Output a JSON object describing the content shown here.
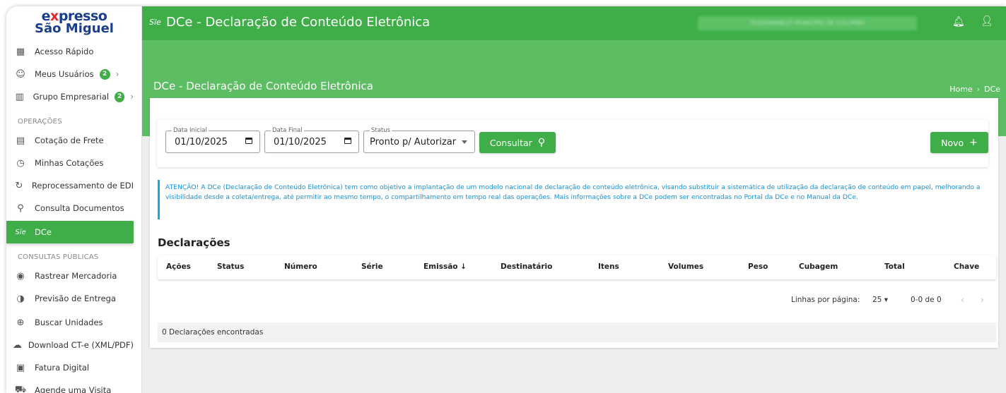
{
  "brand": {
    "logo_top_prefix": "e",
    "logo_top_accent": "x",
    "logo_top_rest": "presso",
    "logo_bottom": "São Miguel"
  },
  "sidebar": {
    "items": [
      {
        "label": "Acesso Rápido",
        "icon": "grid-icon"
      },
      {
        "label": "Meus Usuários",
        "icon": "face-icon",
        "badge": "2"
      },
      {
        "label": "Grupo Empresarial",
        "icon": "building-icon",
        "badge": "2"
      }
    ],
    "section_ops": "OPERAÇÕES",
    "ops_items": [
      {
        "label": "Cotação de Frete",
        "icon": "clipboard-icon"
      },
      {
        "label": "Minhas Cotações",
        "icon": "clock-icon"
      },
      {
        "label": "Reprocessamento de EDI",
        "icon": "sync-icon"
      },
      {
        "label": "Consulta Documentos",
        "icon": "search-icon"
      },
      {
        "label": "DCe",
        "icon": "dce-icon",
        "icon_text": "Sïe"
      }
    ],
    "section_public": "CONSULTAS PÚBLICAS",
    "public_items": [
      {
        "label": "Rastrear Mercadoria",
        "icon": "target-icon"
      },
      {
        "label": "Previsão de Entrega",
        "icon": "half-circle-icon"
      },
      {
        "label": "Buscar Unidades",
        "icon": "add-circle-icon"
      },
      {
        "label": "Download CT-e (XML/PDF)",
        "icon": "cloud-download-icon"
      },
      {
        "label": "Fatura Digital",
        "icon": "pdf-icon"
      },
      {
        "label": "Agende uma Visita",
        "icon": "truck-icon"
      }
    ]
  },
  "topbar": {
    "icon_text": "Sïe",
    "title": "DCe - Declaração de Conteúdo Eletrônica",
    "user_name": "TEODEMANELTI MUNICIPIO DE COLOMBO"
  },
  "header": {
    "page_title": "DCe - Declaração de Conteúdo Eletrônica",
    "breadcrumb_home": "Home",
    "breadcrumb_sep": "›",
    "breadcrumb_current": "DCe"
  },
  "filters": {
    "start_label": "Data Inicial",
    "start_value": "01/10/2025",
    "end_label": "Data Final",
    "end_value": "01/10/2025",
    "status_label": "Status",
    "status_value": "Pronto p/ Autorizar",
    "search_button": "Consultar",
    "new_button": "Novo"
  },
  "alert": {
    "text": "ATENÇÃO! A DCe (Declaração de Conteúdo Eletrônica) tem como objetivo a implantação de um modelo nacional de declaração de conteúdo eletrônica, visando substituir a sistemática de utilização da declaração de conteúdo em papel, melhorando a visibilidade desde a coleta/entrega, até permitir ao mesmo tempo, o compartilhamento em tempo real das operações. Mais informações sobre a DCe podem ser encontradas no Portal da DCe e no Manual da DCe."
  },
  "table": {
    "title": "Declarações",
    "columns": [
      "Ações",
      "Status",
      "Número",
      "Série",
      "Emissão ↓",
      "Destinatário",
      "Itens",
      "Volumes",
      "Peso",
      "Cubagem",
      "Total",
      "Chave"
    ],
    "rows_per_page_label": "Linhas por página:",
    "rows_per_page_value": "25",
    "range_text": "0-0 de 0",
    "prev": "‹",
    "next": "›",
    "footer": "0 Declarações encontradas"
  },
  "colors": {
    "primary": "#3fae49",
    "band": "#5cbd63",
    "info": "#1a8fd6"
  }
}
